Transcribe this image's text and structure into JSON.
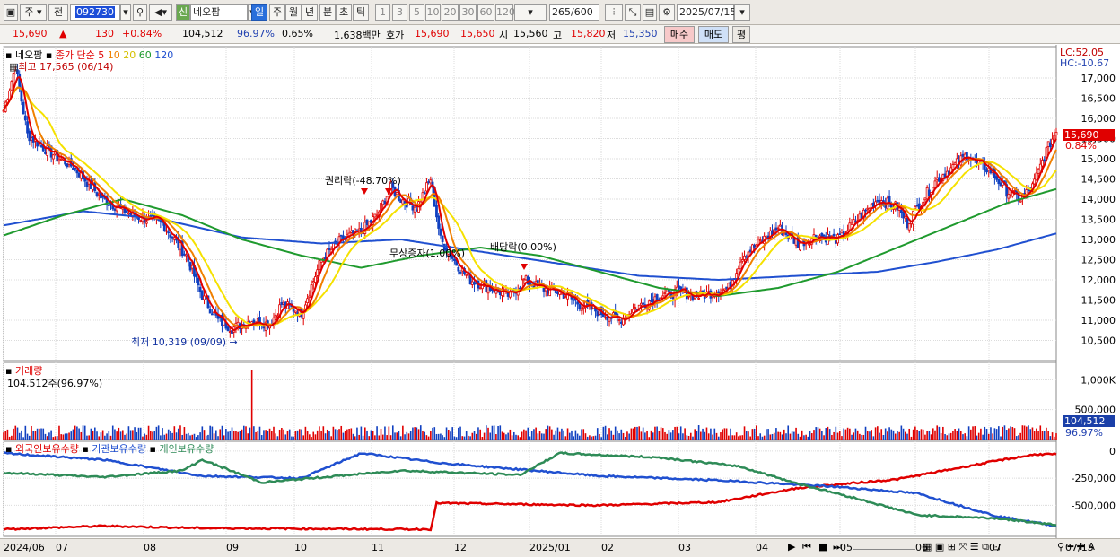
{
  "toolbar": {
    "market": "주",
    "type": "전",
    "code": "092730",
    "name_tag": "신",
    "name": "네오팜",
    "periods": [
      "일",
      "주",
      "월",
      "년",
      "분",
      "초",
      "틱"
    ],
    "selected_period": "일",
    "intervals": [
      "1",
      "3",
      "5",
      "10",
      "20",
      "30",
      "60",
      "120"
    ],
    "count": "265",
    "count_total": "/600",
    "date": "2025/07/15"
  },
  "infobar": {
    "price": "15,690",
    "arrow": "▲",
    "change": "130",
    "change_pct": "+0.84%",
    "volume": "104,512",
    "ratio": "96.97%",
    "turnover": "0.65%",
    "amount": "1,638백만",
    "hoga_label": "호가",
    "ask": "15,690",
    "bid": "15,650",
    "open_label": "시",
    "open": "15,560",
    "high_label": "고",
    "high": "15,820",
    "low_label": "저",
    "low": "15,350",
    "buy": "매수",
    "sell": "매도",
    "eval": "평"
  },
  "legend": {
    "name": "네오팜",
    "ma_label": "종가 단순",
    "ma_periods": [
      "5",
      "10",
      "20",
      "60",
      "120"
    ],
    "max_note": "최고 17,565 (06/14)",
    "min_note": "최저 10,319 (09/09)",
    "right_lc": "LC:52.05",
    "right_hc": "HC:-10.67",
    "annot_rights": "권리락(-48.70%)",
    "annot_free": "무상증자(1.00%)",
    "annot_div": "배당락(0.00%)",
    "last_price": "15,690",
    "last_pct": "0.84%"
  },
  "volume_panel": {
    "title": "거래량",
    "value": "104,512주(96.97%)",
    "axis": [
      "1,000K",
      "500,000"
    ],
    "last": "104,512",
    "last_pct": "96.97%"
  },
  "holding_panel": {
    "series_names": [
      "외국인보유수량",
      "기관보유수량",
      "개인보유수량"
    ],
    "axis": [
      "0",
      "-250,000",
      "-500,000"
    ]
  },
  "xaxis": {
    "labels": [
      "2024/06",
      "07",
      "08",
      "09",
      "10",
      "11",
      "12",
      "2025/01",
      "02",
      "03",
      "04",
      "05",
      "06",
      "07"
    ],
    "right_label": "07/15"
  },
  "colors": {
    "ma5": "#e00000",
    "ma10": "#f08000",
    "ma20": "#f5e100",
    "ma60": "#1f9a2e",
    "ma120": "#2050d0",
    "up": "#e00000",
    "down": "#1040c0",
    "foreign": "#e00000",
    "inst": "#2050d0",
    "indiv": "#2e8b57"
  },
  "chart_data": [
    {
      "type": "line",
      "title": "네오팜",
      "yticks": [
        10500,
        11000,
        11500,
        12000,
        12500,
        13000,
        13500,
        14000,
        14500,
        15000,
        15500,
        16000,
        16500,
        17000
      ],
      "ylim": [
        10000,
        17600
      ],
      "x_months": [
        "2024/06",
        "07",
        "08",
        "09",
        "10",
        "11",
        "12",
        "2025/01",
        "02",
        "03",
        "04",
        "05",
        "06",
        "07"
      ],
      "close_path": [
        [
          0,
          16200
        ],
        [
          6,
          17300
        ],
        [
          12,
          15600
        ],
        [
          22,
          15200
        ],
        [
          35,
          14800
        ],
        [
          50,
          14000
        ],
        [
          65,
          13600
        ],
        [
          80,
          13400
        ],
        [
          92,
          12600
        ],
        [
          100,
          11600
        ],
        [
          108,
          11000
        ],
        [
          115,
          10800
        ],
        [
          125,
          11000
        ],
        [
          134,
          10900
        ],
        [
          140,
          11400
        ],
        [
          150,
          11200
        ],
        [
          160,
          12500
        ],
        [
          170,
          13000
        ],
        [
          180,
          13200
        ],
        [
          188,
          13600
        ],
        [
          195,
          14300
        ],
        [
          200,
          14000
        ],
        [
          208,
          13800
        ],
        [
          215,
          14500
        ],
        [
          220,
          13000
        ],
        [
          228,
          12400
        ],
        [
          235,
          12000
        ],
        [
          245,
          11800
        ],
        [
          255,
          11600
        ],
        [
          262,
          12000
        ],
        [
          270,
          11800
        ],
        [
          280,
          11700
        ],
        [
          290,
          11400
        ],
        [
          300,
          11200
        ],
        [
          310,
          11000
        ],
        [
          318,
          11300
        ],
        [
          330,
          11600
        ],
        [
          340,
          11700
        ],
        [
          350,
          11600
        ],
        [
          358,
          11700
        ],
        [
          365,
          11800
        ],
        [
          372,
          12600
        ],
        [
          380,
          12900
        ],
        [
          390,
          13300
        ],
        [
          400,
          12900
        ],
        [
          410,
          13100
        ],
        [
          420,
          13000
        ],
        [
          430,
          13500
        ],
        [
          440,
          14000
        ],
        [
          450,
          13800
        ],
        [
          455,
          13400
        ],
        [
          460,
          13800
        ],
        [
          470,
          14500
        ],
        [
          478,
          14800
        ],
        [
          485,
          15100
        ],
        [
          490,
          14900
        ],
        [
          497,
          14700
        ],
        [
          505,
          14200
        ],
        [
          512,
          14000
        ],
        [
          518,
          14300
        ],
        [
          525,
          15200
        ],
        [
          530,
          15690
        ]
      ],
      "ma60_path": [
        [
          0,
          13100
        ],
        [
          30,
          13600
        ],
        [
          60,
          14000
        ],
        [
          90,
          13600
        ],
        [
          120,
          13000
        ],
        [
          150,
          12600
        ],
        [
          180,
          12300
        ],
        [
          210,
          12600
        ],
        [
          240,
          12800
        ],
        [
          270,
          12600
        ],
        [
          300,
          12200
        ],
        [
          330,
          11800
        ],
        [
          360,
          11600
        ],
        [
          390,
          11800
        ],
        [
          420,
          12200
        ],
        [
          450,
          12800
        ],
        [
          480,
          13400
        ],
        [
          505,
          13900
        ],
        [
          530,
          14250
        ]
      ],
      "ma120_path": [
        [
          0,
          13350
        ],
        [
          40,
          13700
        ],
        [
          80,
          13500
        ],
        [
          120,
          13050
        ],
        [
          160,
          12900
        ],
        [
          200,
          13000
        ],
        [
          240,
          12700
        ],
        [
          280,
          12400
        ],
        [
          320,
          12100
        ],
        [
          360,
          12000
        ],
        [
          400,
          12100
        ],
        [
          440,
          12200
        ],
        [
          470,
          12450
        ],
        [
          500,
          12750
        ],
        [
          530,
          13150
        ]
      ]
    },
    {
      "type": "bar",
      "title": "거래량",
      "ylim": [
        0,
        1200000
      ],
      "yticks": [
        500000,
        1000000
      ],
      "spike_day": 125,
      "spike_value": 1170000,
      "last_value": 104512
    },
    {
      "type": "line",
      "series": [
        {
          "name": "외국인보유수량",
          "path": [
            [
              0,
              -720000
            ],
            [
              50,
              -690000
            ],
            [
              100,
              -710000
            ],
            [
              200,
              -720000
            ],
            [
              215,
              -720000
            ],
            [
              218,
              -480000
            ],
            [
              300,
              -500000
            ],
            [
              360,
              -470000
            ],
            [
              400,
              -340000
            ],
            [
              450,
              -260000
            ],
            [
              500,
              -90000
            ],
            [
              520,
              -30000
            ],
            [
              530,
              -30000
            ]
          ]
        },
        {
          "name": "기관보유수량",
          "path": [
            [
              0,
              -20000
            ],
            [
              50,
              -80000
            ],
            [
              100,
              -230000
            ],
            [
              150,
              -250000
            ],
            [
              180,
              -20000
            ],
            [
              220,
              -110000
            ],
            [
              300,
              -230000
            ],
            [
              360,
              -270000
            ],
            [
              420,
              -330000
            ],
            [
              460,
              -390000
            ],
            [
              500,
              -600000
            ],
            [
              530,
              -690000
            ]
          ]
        },
        {
          "name": "개인보유수량",
          "path": [
            [
              0,
              -200000
            ],
            [
              50,
              -240000
            ],
            [
              90,
              -180000
            ],
            [
              100,
              -80000
            ],
            [
              130,
              -290000
            ],
            [
              200,
              -180000
            ],
            [
              260,
              -220000
            ],
            [
              280,
              -20000
            ],
            [
              330,
              -60000
            ],
            [
              370,
              -140000
            ],
            [
              400,
              -300000
            ],
            [
              430,
              -440000
            ],
            [
              460,
              -590000
            ],
            [
              500,
              -620000
            ],
            [
              530,
              -680000
            ]
          ]
        }
      ],
      "ylim": [
        -720000,
        40000
      ],
      "yticks": [
        0,
        -250000,
        -500000
      ]
    }
  ]
}
